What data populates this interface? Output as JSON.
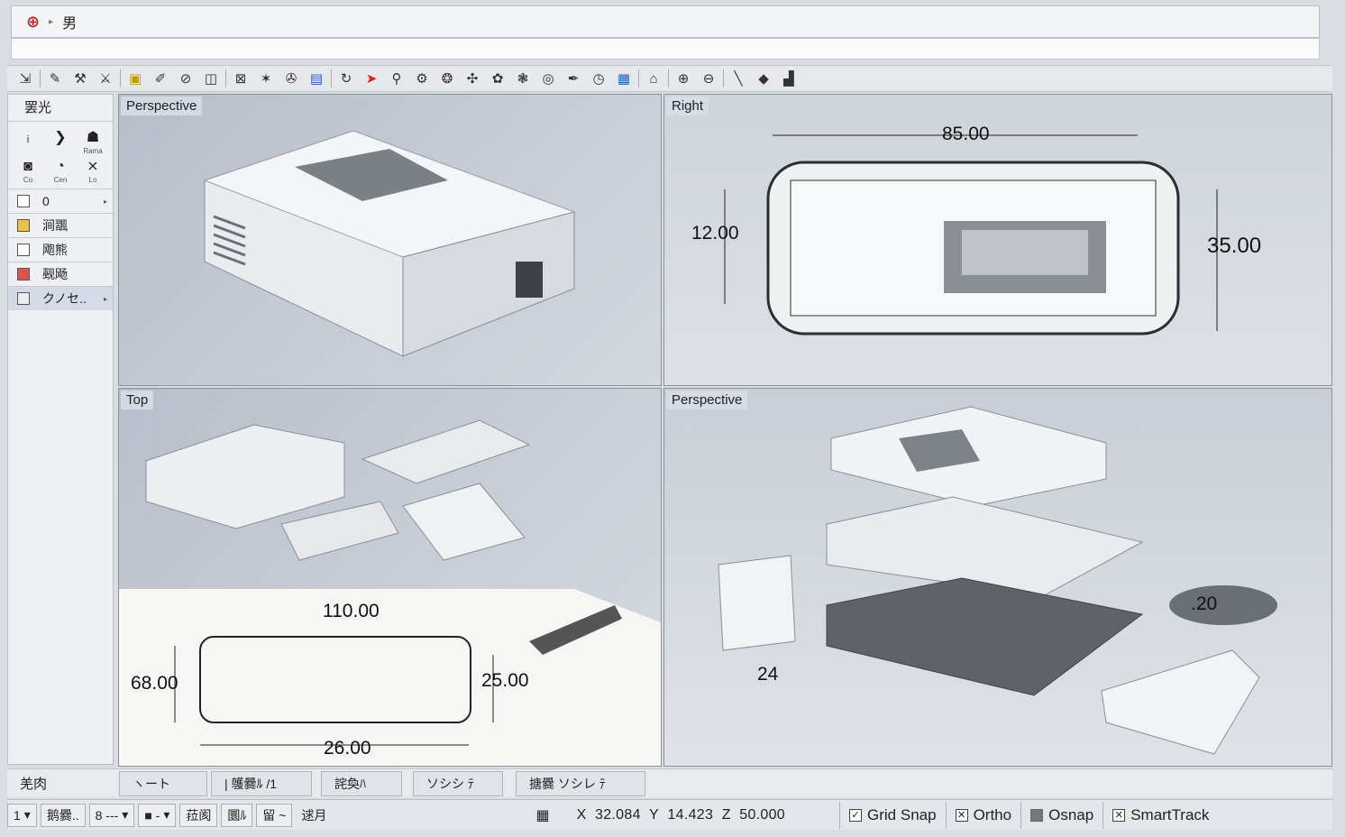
{
  "command": {
    "glyph": "⊕",
    "label": "男"
  },
  "toolbar_icons": [
    "move-icon",
    "pencil-icon",
    "tool-icon",
    "hammer-icon",
    "layer-icon",
    "edit-icon",
    "attach-icon",
    "box-icon",
    "transform-icon",
    "star-icon",
    "wrench-icon",
    "image-icon",
    "rotate-icon",
    "arrow-icon",
    "zoom-extents-icon",
    "gear1-icon",
    "gear2-icon",
    "gear3-icon",
    "gear4-icon",
    "gear5-icon",
    "eye-icon",
    "pen-icon",
    "clock-icon",
    "grid-icon",
    "home-icon",
    "zoom-in-icon",
    "zoom-out-icon",
    "line-icon",
    "diamond-icon",
    "stair-icon"
  ],
  "left_panel": {
    "title": "罢光",
    "icons": [
      {
        "glyph": "ᵢ",
        "label": ""
      },
      {
        "glyph": "❯",
        "label": ""
      },
      {
        "glyph": "☗",
        "label": "Rama"
      },
      {
        "glyph": "◙",
        "label": "Co"
      },
      {
        "glyph": "◔",
        "label": "Cen"
      },
      {
        "glyph": "⨯",
        "label": "Lo"
      }
    ],
    "layers": [
      {
        "name": "0",
        "selected": false
      },
      {
        "name": "涧飁",
        "selected": false
      },
      {
        "name": "飑熊",
        "selected": false
      },
      {
        "name": "觋飏",
        "selected": false
      },
      {
        "name": "クノセ..",
        "selected": true
      }
    ]
  },
  "viewports": {
    "top_left": {
      "label": "Perspective"
    },
    "top_right": {
      "label": "Right",
      "dims": [
        "85.00",
        "12.00",
        "35.00"
      ]
    },
    "bottom_left": {
      "label": "Top",
      "dims": [
        "110.00",
        "68.00",
        "25.00",
        "26.00"
      ]
    },
    "bottom_right": {
      "label": "Perspective",
      "dims": [
        ".20",
        "24"
      ]
    }
  },
  "viewport_tabs": {
    "panel_label": "羌肉",
    "tabs": [
      "ヽート",
      "| 鹱爨ﾙ /1",
      "詫奐ﾊ",
      "ソシシ ﾃ",
      "搪爨 ソシレ ﾃ"
    ]
  },
  "status": {
    "left": [
      "1",
      "鹅爨..",
      "8 ---",
      "■ -",
      "菈阂",
      "圜ﾙ",
      "留 ~",
      "逑月"
    ],
    "coords": {
      "x": "32.084",
      "y": "14.423",
      "z": "50.000"
    },
    "snaps": [
      {
        "label": "Grid Snap",
        "checked": true
      },
      {
        "label": "Ortho",
        "checked": true
      },
      {
        "label": "Osnap",
        "checked": false
      },
      {
        "label": "SmartTrack",
        "checked": true
      }
    ]
  }
}
